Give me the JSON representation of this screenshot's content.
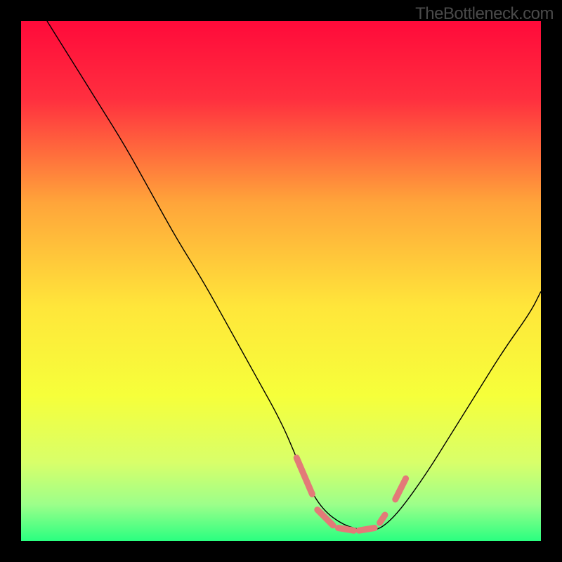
{
  "watermark": "TheBottleneck.com",
  "chart_data": {
    "type": "line",
    "title": "",
    "xlabel": "",
    "ylabel": "",
    "xlim": [
      0,
      100
    ],
    "ylim": [
      0,
      100
    ],
    "background": {
      "style": "vertical-gradient",
      "stops": [
        {
          "offset": 0,
          "color": "#ff0a3a"
        },
        {
          "offset": 0.15,
          "color": "#ff2f3f"
        },
        {
          "offset": 0.35,
          "color": "#ffa53a"
        },
        {
          "offset": 0.55,
          "color": "#ffe63a"
        },
        {
          "offset": 0.72,
          "color": "#f6ff3a"
        },
        {
          "offset": 0.85,
          "color": "#d8ff6a"
        },
        {
          "offset": 0.93,
          "color": "#9cff8a"
        },
        {
          "offset": 1.0,
          "color": "#2aff80"
        }
      ]
    },
    "series": [
      {
        "name": "bottleneck-curve",
        "stroke": "#000000",
        "stroke_width": 1.4,
        "x": [
          5,
          10,
          15,
          20,
          25,
          30,
          35,
          40,
          45,
          50,
          53,
          55,
          58,
          62,
          66,
          68,
          70,
          73,
          78,
          83,
          88,
          93,
          98,
          100
        ],
        "y": [
          100,
          92,
          84,
          76,
          67,
          58,
          50,
          41,
          32,
          23,
          16,
          11,
          6,
          3,
          2,
          2,
          3,
          6,
          13,
          21,
          29,
          37,
          44,
          48
        ]
      },
      {
        "name": "overlay-dashes",
        "stroke": "#e37a78",
        "stroke_width": 9,
        "linecap": "round",
        "segments": [
          {
            "x1": 53,
            "y1": 16,
            "x2": 56,
            "y2": 9
          },
          {
            "x1": 57,
            "y1": 6,
            "x2": 60,
            "y2": 3
          },
          {
            "x1": 61,
            "y1": 2.5,
            "x2": 64,
            "y2": 2
          },
          {
            "x1": 65,
            "y1": 2,
            "x2": 68,
            "y2": 2.5
          },
          {
            "x1": 69,
            "y1": 3.5,
            "x2": 70,
            "y2": 5
          },
          {
            "x1": 72,
            "y1": 8,
            "x2": 74,
            "y2": 12
          }
        ]
      }
    ]
  }
}
